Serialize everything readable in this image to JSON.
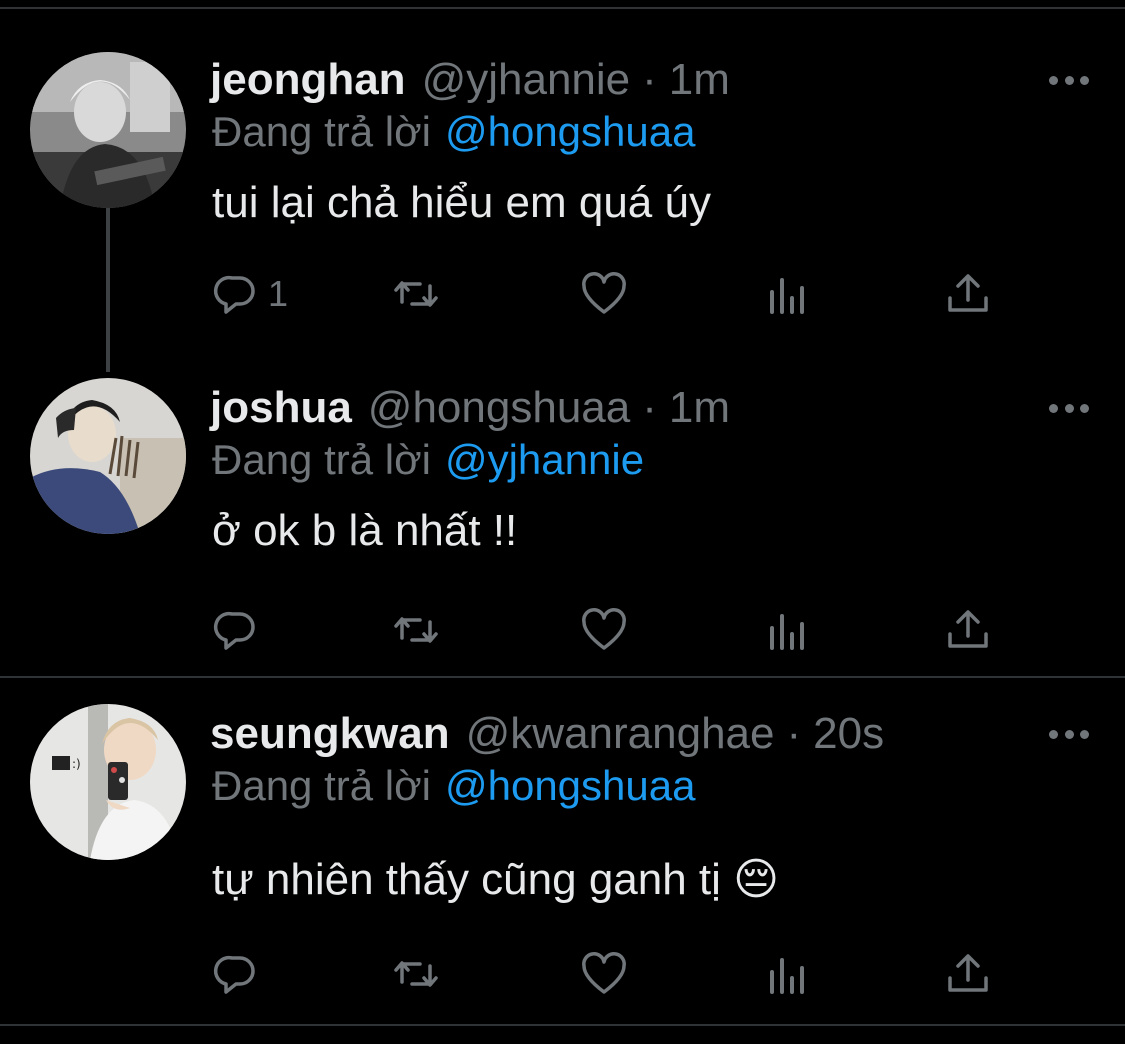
{
  "colors": {
    "background": "#000000",
    "text_primary": "#e7e9ea",
    "text_secondary": "#71767b",
    "accent": "#1d9bf0",
    "divider": "#2f3336"
  },
  "tweets": [
    {
      "name": "jeonghan",
      "handle": "@yjhannie",
      "dot": "·",
      "time": "1m",
      "reply_prefix": "Đang trả lời",
      "reply_to": "@hongshuaa",
      "text": "tui lại chả hiểu em quá úy",
      "reply_count": "1",
      "avatar_icon": "avatar-photo",
      "more_icon": "more-options-icon"
    },
    {
      "name": "joshua",
      "handle": "@hongshuaa",
      "dot": "·",
      "time": "1m",
      "reply_prefix": "Đang trả lời",
      "reply_to": "@yjhannie",
      "text": "ở ok b là nhất !!",
      "reply_count": "",
      "avatar_icon": "avatar-photo",
      "more_icon": "more-options-icon"
    },
    {
      "name": "seungkwan",
      "handle": "@kwanranghae",
      "dot": "·",
      "time": "20s",
      "reply_prefix": "Đang trả lời",
      "reply_to": "@hongshuaa",
      "text": "tự nhiên thấy cũng ganh tị 😔",
      "reply_count": "",
      "avatar_icon": "avatar-photo",
      "more_icon": "more-options-icon"
    }
  ],
  "action_icons": [
    "reply-icon",
    "retweet-icon",
    "like-icon",
    "analytics-icon",
    "share-icon"
  ]
}
